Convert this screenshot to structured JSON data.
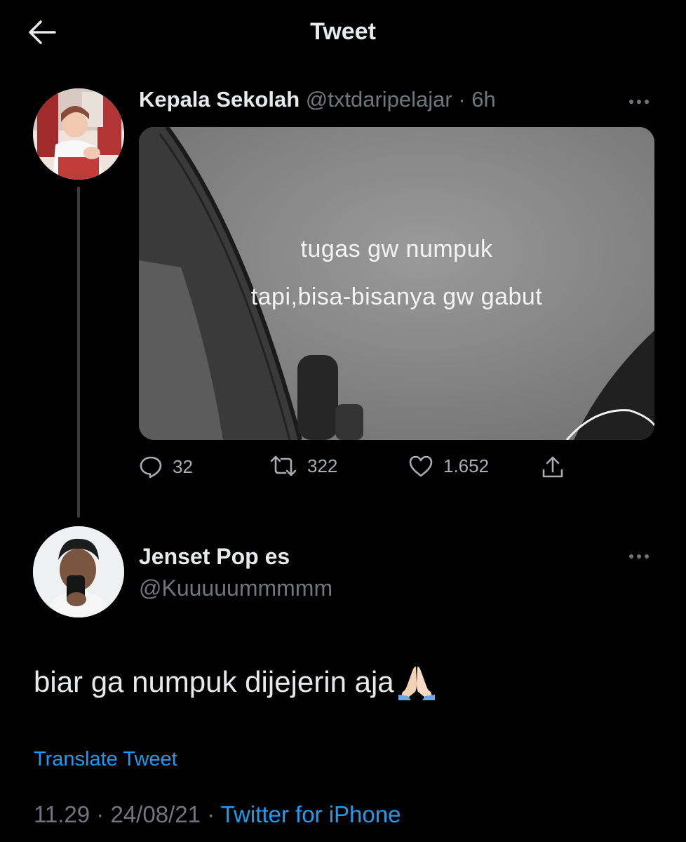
{
  "header": {
    "title": "Tweet",
    "back_icon": "arrow-left-icon"
  },
  "parent_tweet": {
    "name": "Kepala Sekolah",
    "handle": "@txtdaripelajar",
    "separator": " · ",
    "time": "6h",
    "media_text": {
      "line1": "tugas gw numpuk",
      "line2": "tapi,bisa-bisanya gw gabut"
    },
    "actions": {
      "replies": "32",
      "retweets": "322",
      "likes": "1.652"
    }
  },
  "reply_tweet": {
    "name": "Jenset Pop es",
    "handle": "@Kuuuuummmmm",
    "text": "biar ga numpuk dijejerin aja",
    "emoji": "folded-hands-icon",
    "translate_label": "Translate Tweet",
    "time": "11.29",
    "date": "24/08/21",
    "separator": " · ",
    "source": "Twitter for iPhone"
  },
  "colors": {
    "background": "#000000",
    "text_primary": "#e7e9ea",
    "text_secondary": "#71767b",
    "link": "#1d9bf0"
  }
}
